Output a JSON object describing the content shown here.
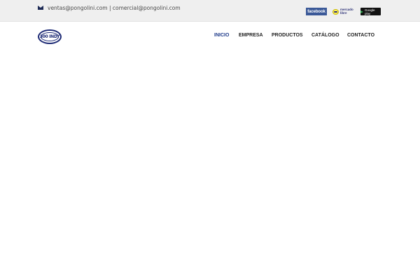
{
  "topbar": {
    "contact_emails": "ventas@pongolini.com | comercial@pongolini.com",
    "contact_icon": "envelope-icon",
    "social": {
      "facebook_label": "facebook",
      "mercadolibre_label": "mercado libre",
      "googleplay_label": "Google play"
    }
  },
  "header": {
    "logo_text": "300 INDY",
    "nav": [
      {
        "label": "INICIO",
        "active": true
      },
      {
        "label": "EMPRESA",
        "active": false
      },
      {
        "label": "PRODUCTOS",
        "active": false
      },
      {
        "label": "CATÁLOGO",
        "active": false
      },
      {
        "label": "CONTACTO",
        "active": false
      }
    ]
  },
  "colors": {
    "topbar_bg": "#efefef",
    "brand_navy": "#1d2a75",
    "nav_active": "#1e3a8a",
    "facebook_blue": "#3b5998"
  }
}
